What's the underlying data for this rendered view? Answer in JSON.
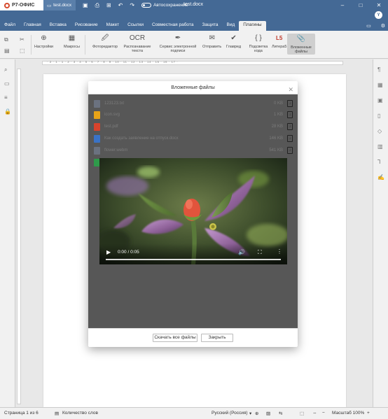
{
  "app": {
    "brand": "Р7-ОФИС",
    "doc_tab": "test.docx",
    "autosave_label": "Автосохранение",
    "title": "test.docx",
    "user_initial": "Y"
  },
  "menu": {
    "tabs": [
      "Файл",
      "Главная",
      "Вставка",
      "Рисование",
      "Макет",
      "Ссылки",
      "Совместная работа",
      "Защита",
      "Вид",
      "Плагины"
    ],
    "active": "Плагины"
  },
  "ribbon": {
    "items": [
      {
        "label": "Настройки"
      },
      {
        "label": "Макросы"
      },
      {
        "label": "Фоторедактор"
      },
      {
        "label": "Распознавание текста"
      },
      {
        "label": "Сервис электронной подписи"
      },
      {
        "label": "Отправить"
      },
      {
        "label": "Главред"
      },
      {
        "label": "Подсветка кода"
      },
      {
        "label": "Литера5"
      },
      {
        "label": "Вложенные файлы"
      }
    ]
  },
  "ruler": {
    "numbers": "· 2 · 1 · 1 · 2 · 3 · 4 · 5 · 6 · 7 · 8 · 9 · 10 · 11 · 12 · 13 · 14 · 15 · 16 · 17 ·"
  },
  "modal": {
    "title": "Вложенные файлы",
    "files": [
      {
        "name": "123123.txt",
        "size": "0 KB",
        "color": "#6b7280"
      },
      {
        "name": "icon.svg",
        "size": "1 KB",
        "color": "#e8a317"
      },
      {
        "name": "test.pdf",
        "size": "28 KB",
        "color": "#d9432c"
      },
      {
        "name": "Как создать заявление на отпуск.docx",
        "size": "146 KB",
        "color": "#3a73c7"
      },
      {
        "name": "flower.webm",
        "size": "541 KB",
        "color": "#6b7280"
      },
      {
        "name": "",
        "size": "",
        "color": "#2e9a4a"
      }
    ],
    "video": {
      "time": "0:00 / 0:05"
    },
    "download_all": "Скачать все файлы",
    "close": "Закрыть"
  },
  "status": {
    "page": "Страница 1 из 6",
    "word_count": "Количество слов",
    "language": "Русский (Россия)",
    "zoom": "Масштаб 100%"
  }
}
